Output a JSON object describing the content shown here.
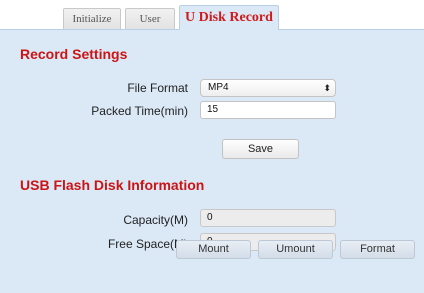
{
  "tabs": {
    "initialize": "Initialize",
    "user": "User",
    "udisk_record": "U Disk Record"
  },
  "record_settings": {
    "title": "Record Settings",
    "file_format_label": "File Format",
    "file_format_value": "MP4",
    "packed_time_label": "Packed Time(min)",
    "packed_time_value": "15",
    "save_label": "Save"
  },
  "usb_info": {
    "title": "USB Flash Disk Information",
    "capacity_label": "Capacity(M)",
    "capacity_value": "0",
    "free_space_label": "Free Space(M)",
    "free_space_value": "0"
  },
  "actions": {
    "mount": "Mount",
    "umount": "Umount",
    "format": "Format"
  },
  "colors": {
    "accent_red": "#cc1414",
    "panel_bg": "#dbe8f6"
  }
}
